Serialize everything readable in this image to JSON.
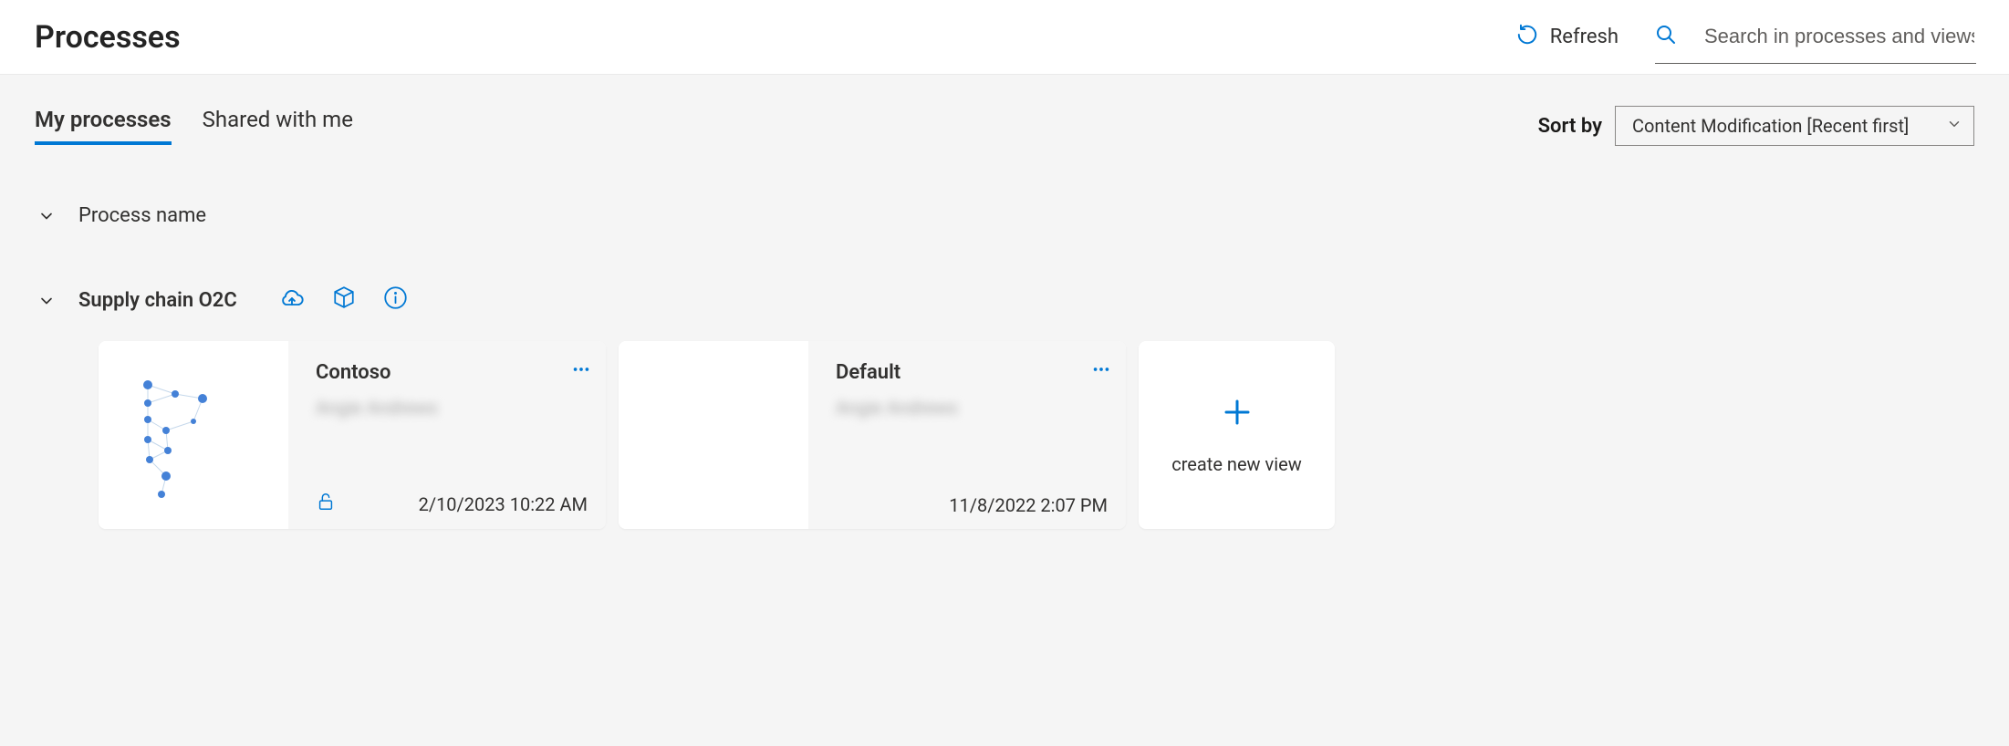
{
  "header": {
    "title": "Processes",
    "refresh_label": "Refresh",
    "search_placeholder": "Search in processes and views"
  },
  "tabs": {
    "my": "My processes",
    "shared": "Shared with me"
  },
  "sort": {
    "label": "Sort by",
    "selected": "Content Modification [Recent first]"
  },
  "sections": {
    "group_header": "Process name",
    "process": {
      "name": "Supply chain O2C"
    }
  },
  "cards": [
    {
      "title": "Contoso",
      "owner": "Angie Andrews",
      "date": "2/10/2023 10:22 AM",
      "has_lock": true
    },
    {
      "title": "Default",
      "owner": "Angie Andrews",
      "date": "11/8/2022 2:07 PM",
      "has_lock": false
    }
  ],
  "new_view_label": "create new view",
  "colors": {
    "accent": "#0078d4"
  }
}
